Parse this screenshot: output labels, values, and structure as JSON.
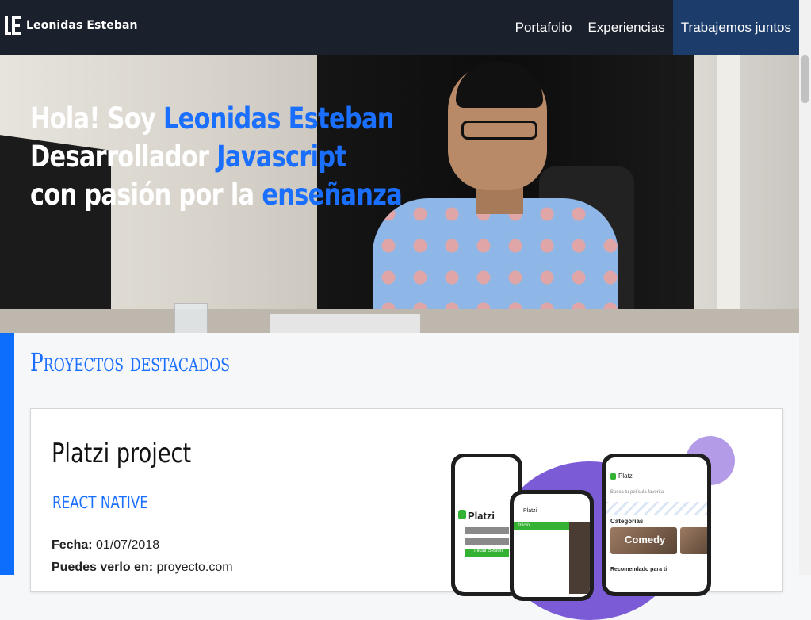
{
  "header": {
    "logo_text": "Leonidas Esteban",
    "nav": [
      {
        "label": "Portafolio"
      },
      {
        "label": "Experiencias"
      },
      {
        "label": "Trabajemos juntos"
      }
    ]
  },
  "hero": {
    "line1_prefix": "Hola! Soy ",
    "line1_highlight": "Leonidas Esteban",
    "line2_prefix": "Desarrollador ",
    "line2_highlight": "Javascript",
    "line3_prefix": "con pasión por la ",
    "line3_highlight": "enseñanza"
  },
  "section": {
    "title": "Proyectos destacados"
  },
  "project": {
    "title": "Platzi project",
    "tag": "REACT NATIVE",
    "date_label": "Fecha:",
    "date_value": "01/07/2018",
    "link_label": "Puedes verlo en:",
    "link_value": "proyecto.com"
  },
  "mockup": {
    "brand": "Platzi",
    "search_placeholder": "Busca tu película favorita",
    "categories_label": "Categorías",
    "tile_label": "Comedy",
    "recommended_label": "Recomendado para ti",
    "login_button": "Iniciar Sesión",
    "menu_home": "Inicio"
  },
  "colors": {
    "accent": "#1b6fff",
    "navbar": "#1a202c",
    "active_nav": "#1c3c6b"
  }
}
